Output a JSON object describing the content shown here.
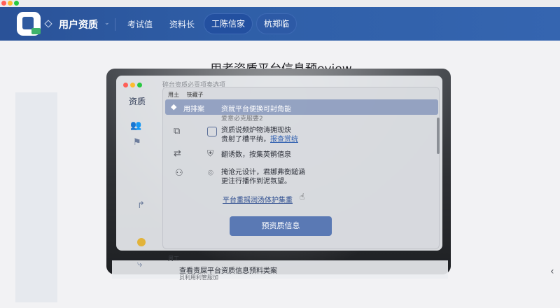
{
  "window": {
    "dots": [
      "#ff5f57",
      "#febc2e",
      "#28c840"
    ]
  },
  "topbar": {
    "brand": "用户资质",
    "caret": "⌄",
    "nav": [
      "考试值",
      "资料长",
      "工陈信家",
      "杭郑临"
    ],
    "active_index": 2
  },
  "page": {
    "title": "用者资质平台信息预eview"
  },
  "inner": {
    "search_placeholder": "碎台资质必贡项奏选项",
    "side_label": "资质"
  },
  "dialog": {
    "top_tags": [
      "用土",
      "筷藏子"
    ],
    "selected_title": "用排案",
    "selected_detail": "资就平台便换可封角能",
    "ghost_line": "爱意必克服要2",
    "rows": [
      {
        "line1": "资质说频炉物涛拥现炔",
        "line2_prefix": "贵射了槽平纳，",
        "line2_link": "报查赏统"
      },
      {
        "line1": "翻诱数，按集英鹡僖泉"
      },
      {
        "line1": "掩沧元设计，君娜弗衡鎚涵",
        "line2": "更注行播作到泥氛望。"
      }
    ],
    "link_text": "平台重摇润汤体护集重",
    "primary_button": "预资质信息"
  },
  "bottom": {
    "tag": "周工",
    "text": "查看责屎平台资质信息预料类案",
    "sub": "员利用利管服加"
  },
  "icons": {
    "logo": "app-logo",
    "chevron_right": "‹",
    "hand": "☝"
  }
}
